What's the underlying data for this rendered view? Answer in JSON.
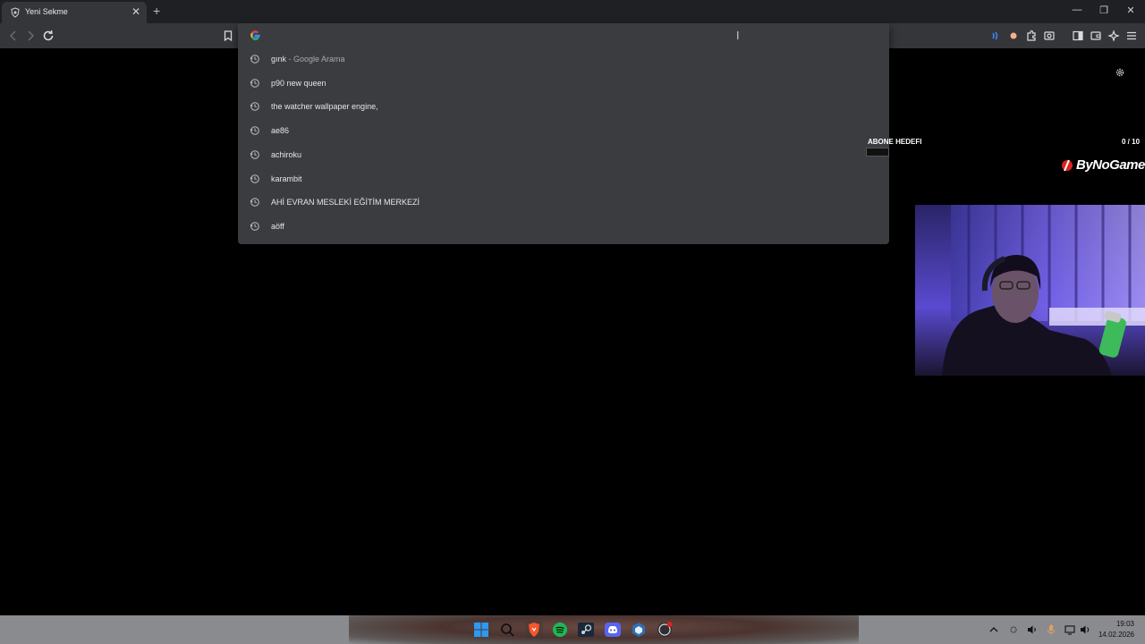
{
  "browser": {
    "tab_title": "Yeni Sekme",
    "tab_close": "✕",
    "new_tab": "+",
    "window_minimize": "—",
    "window_restore": "❐",
    "window_close": "✕"
  },
  "omnibox": {
    "input_value": "",
    "cursor_glyph": "I",
    "suggestions": [
      {
        "text": "gınk",
        "sub": " - Google Arama"
      },
      {
        "text": "p90 new queen",
        "sub": ""
      },
      {
        "text": "the watcher wallpaper engine,",
        "sub": ""
      },
      {
        "text": "ae86",
        "sub": ""
      },
      {
        "text": "achiroku",
        "sub": ""
      },
      {
        "text": "karambit",
        "sub": ""
      },
      {
        "text": "AHİ EVRAN MESLEKİ EĞİTİM MERKEZİ",
        "sub": ""
      },
      {
        "text": "aöff",
        "sub": ""
      }
    ]
  },
  "overlay": {
    "goal_label": "ABONE HEDEFI",
    "goal_count": "0  / 10",
    "goal_progress": 0,
    "brand": "ByNoGame"
  },
  "taskbar": {
    "time": "19:03",
    "date": "14.02.2026",
    "apps": [
      "windows-start-icon",
      "search-icon",
      "brave-browser-icon",
      "spotify-icon",
      "steam-icon",
      "discord-icon",
      "app-icon",
      "obs-icon"
    ]
  },
  "colors": {
    "tabstrip": "#1f2023",
    "toolbar": "#35363a",
    "dropdown": "#3b3c40",
    "brand_red": "#e02020",
    "taskbar": "#8a8b8e"
  }
}
